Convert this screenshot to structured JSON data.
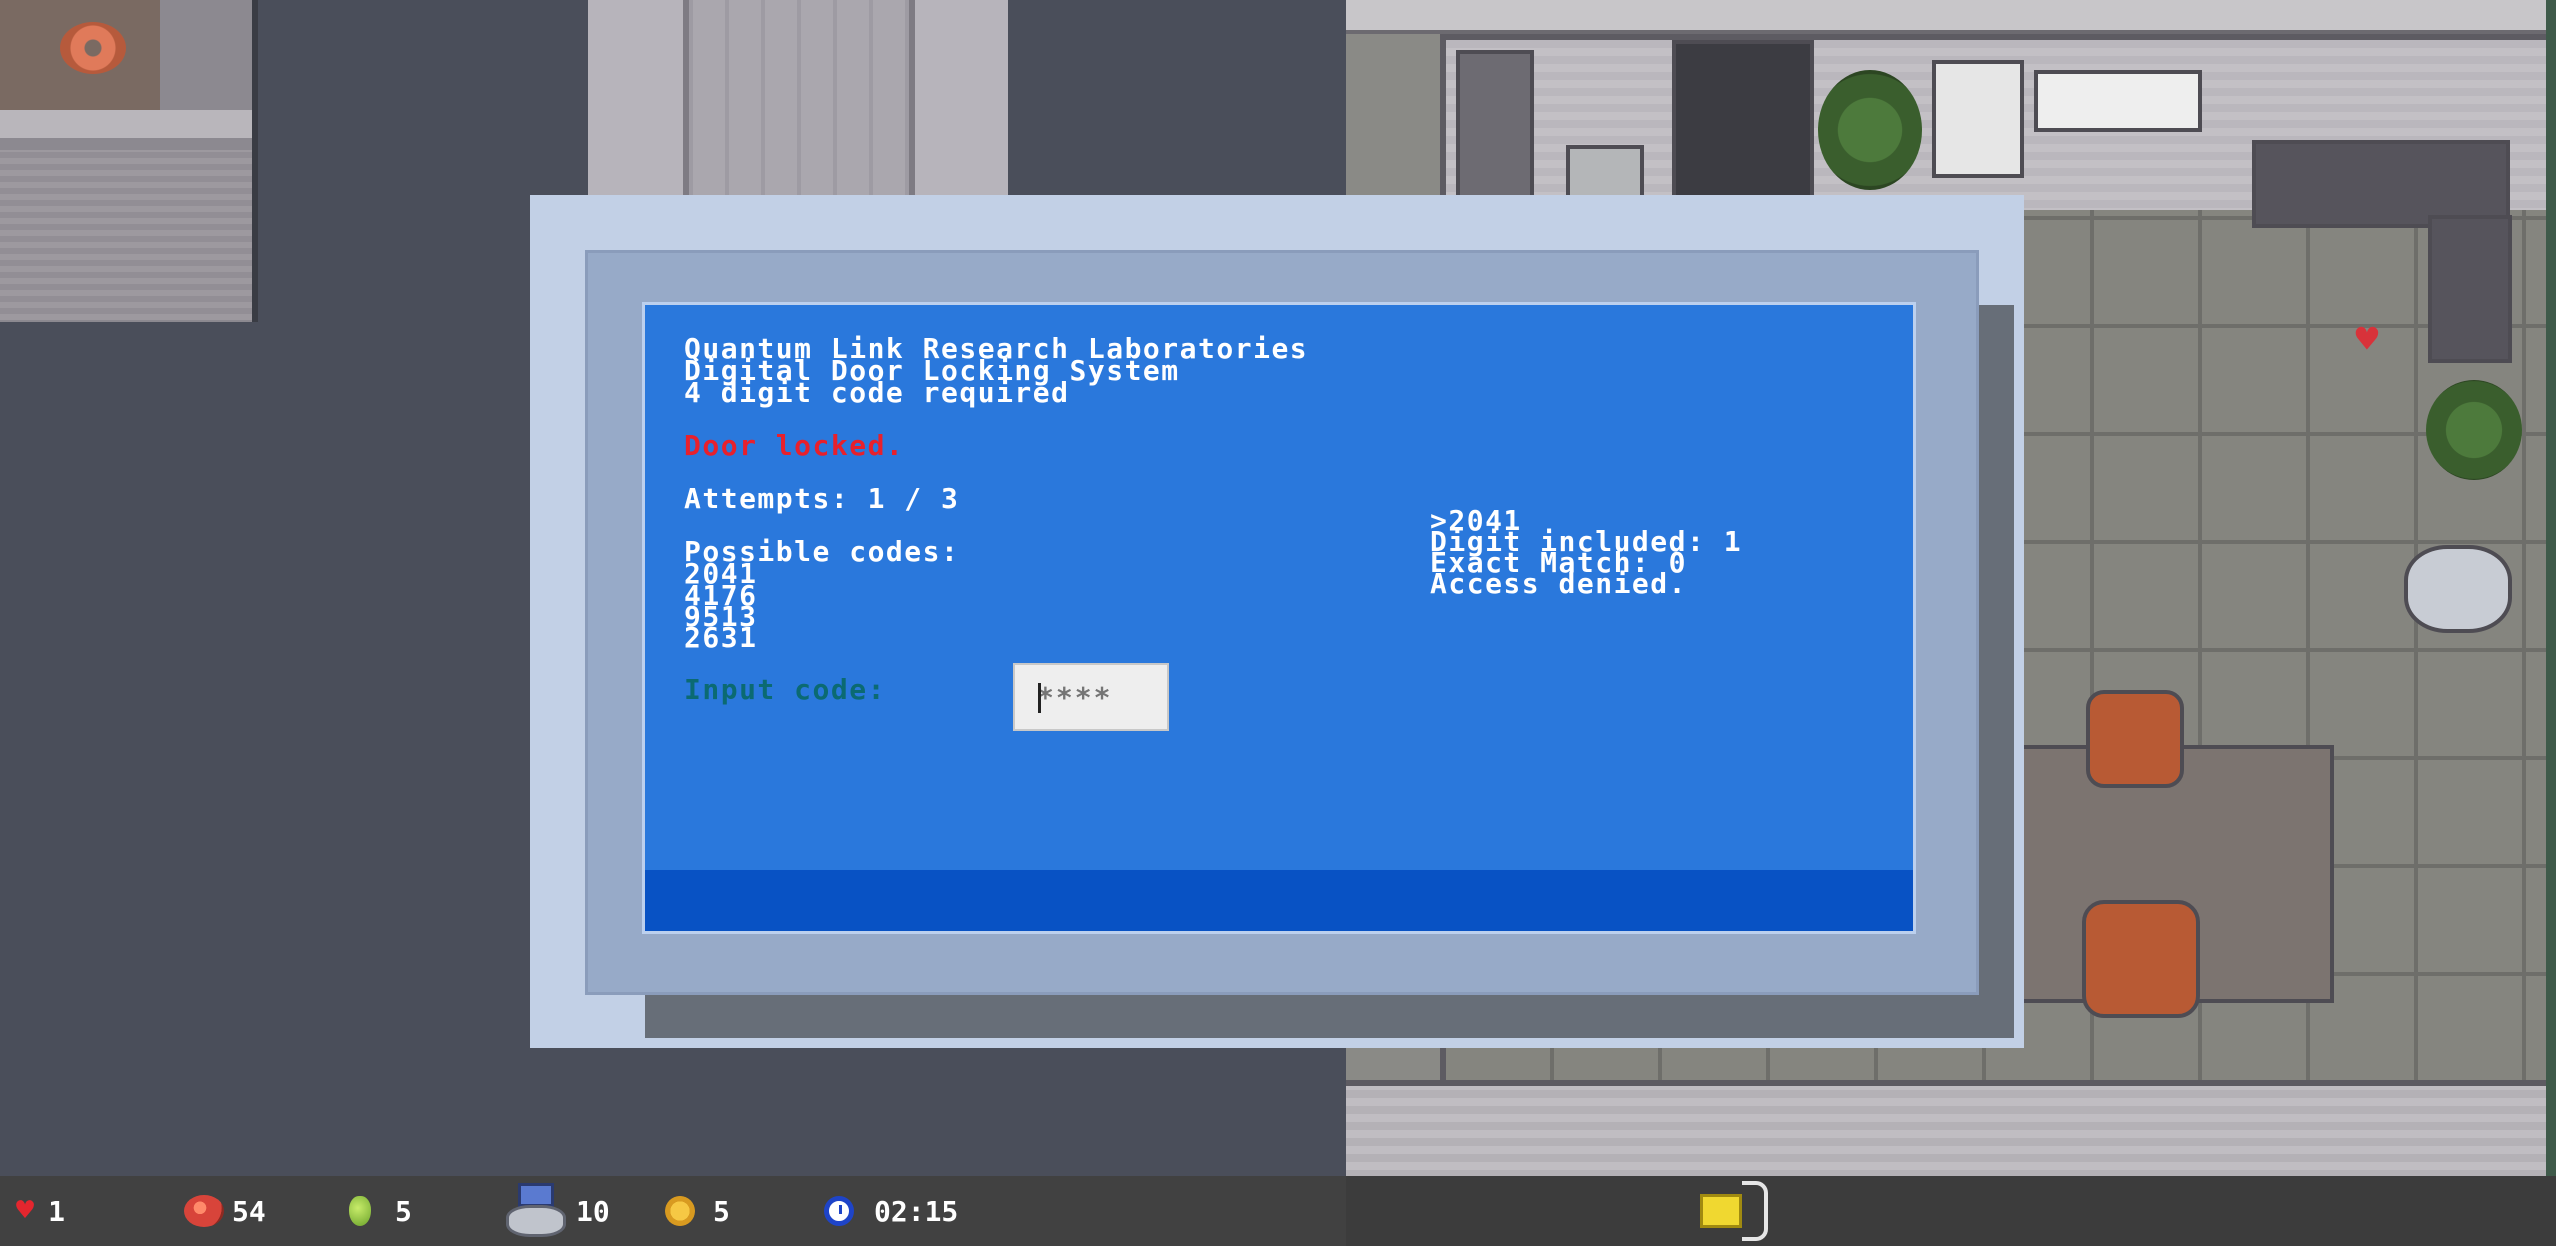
{
  "terminal": {
    "header_line1": "Quantum Link Research Laboratories",
    "header_line2": "Digital Door Locking System",
    "header_line3": "4 digit code required",
    "status": "Door locked.",
    "attempts": "Attempts: 1 / 3",
    "possible_codes_label": "Possible codes:",
    "possible_codes": [
      "2041",
      "4176",
      "9513",
      "2631"
    ],
    "input_label": "Input code:",
    "input_placeholder": "****",
    "input_value": "",
    "log": [
      ">2041",
      "Digit included: 1",
      "Exact Match: 0",
      "Access denied."
    ],
    "colors": {
      "screen": "#2a78dc",
      "status_text": "#e8202c",
      "input_label": "#0b6a72"
    }
  },
  "hud": {
    "health": "1",
    "food": "54",
    "grenades": "5",
    "robots": "10",
    "coins": "5",
    "timer": "02:15",
    "icons": [
      "heart-icon",
      "meat-icon",
      "grenade-icon",
      "robot-icon",
      "coin-icon",
      "clock-icon",
      "keycard-icon"
    ]
  }
}
